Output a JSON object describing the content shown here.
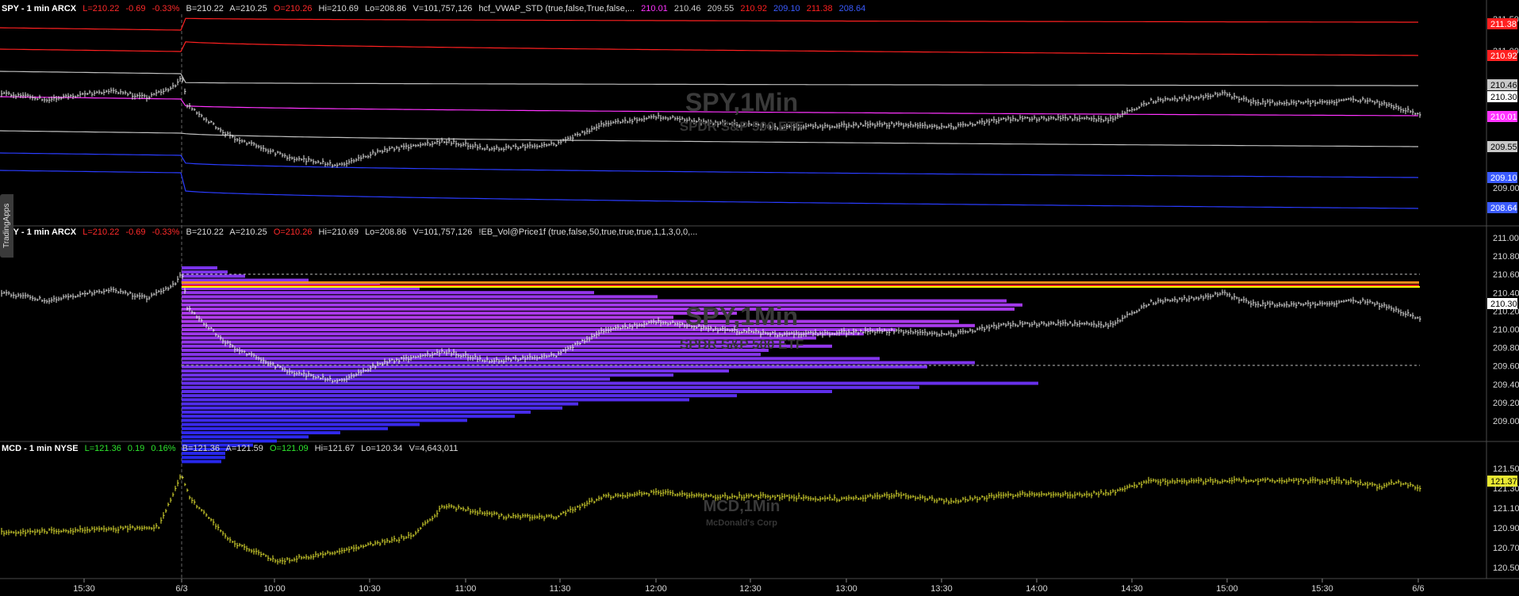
{
  "panels": [
    {
      "id": "spy-vwap",
      "header": {
        "symbol": "SPY - 1 min  ARCX",
        "last": "L=210.22",
        "change": "-0.69",
        "change_pct": "-0.33%",
        "bid": "B=210.22",
        "ask": "A=210.25",
        "open": "O=210.26",
        "high": "Hi=210.69",
        "low": "Lo=208.86",
        "volume": "V=101,757,126",
        "study": "hcf_VWAP_STD (true,false,True,false,...",
        "study_values": [
          "210.01",
          "210.46",
          "209.55",
          "210.92",
          "209.10",
          "211.38",
          "208.64"
        ],
        "study_value_colors": [
          "#ff33ff",
          "#c8c8c8",
          "#c8c8c8",
          "#ff2020",
          "#3a5bff",
          "#ff2020",
          "#3a5bff"
        ]
      },
      "watermark": {
        "title": "SPY,1Min",
        "subtitle": "SPDR S&P 500 ETF"
      },
      "axis_ticks": [
        "211.50",
        "211.00",
        "209.00"
      ],
      "price_labels": [
        {
          "text": "211.38",
          "color": "#ff2020",
          "value": 211.38
        },
        {
          "text": "210.92",
          "color": "#ff2020",
          "value": 210.92
        },
        {
          "text": "210.46",
          "color": "#c8c8c8",
          "value": 210.46
        },
        {
          "text": "210.30",
          "color": "#ffffff",
          "value": 210.3
        },
        {
          "text": "210.01",
          "color": "#ff33ff",
          "value": 210.01
        },
        {
          "text": "209.55",
          "color": "#c8c8c8",
          "value": 209.55
        },
        {
          "text": "209.10",
          "color": "#3a5bff",
          "value": 209.1
        },
        {
          "text": "208.64",
          "color": "#3a5bff",
          "value": 208.64
        }
      ]
    },
    {
      "id": "spy-volprofile",
      "header": {
        "symbol": "SPY - 1 min  ARCX",
        "last": "L=210.22",
        "change": "-0.69",
        "change_pct": "-0.33%",
        "bid": "B=210.22",
        "ask": "A=210.25",
        "open": "O=210.26",
        "high": "Hi=210.69",
        "low": "Lo=208.86",
        "volume": "V=101,757,126",
        "study": "!EB_Vol@Price1f (true,false,50,true,true,true,1,1,3,0,0,..."
      },
      "watermark": {
        "title": "SPY,1Min",
        "subtitle": "SPDR S&P 500 ETF"
      },
      "axis_ticks": [
        "211.00",
        "210.80",
        "210.60",
        "210.40",
        "210.20",
        "210.00",
        "209.80",
        "209.60",
        "209.40",
        "209.20",
        "209.00"
      ],
      "last_label": "210.30"
    },
    {
      "id": "mcd",
      "header": {
        "symbol": "MCD - 1 min  NYSE",
        "last": "L=121.36",
        "change": "0.19",
        "change_pct": "0.16%",
        "bid": "B=121.36",
        "ask": "A=121.59",
        "open": "O=121.09",
        "high": "Hi=121.67",
        "low": "Lo=120.34",
        "volume": "V=4,643,011"
      },
      "watermark": {
        "title": "MCD,1Min",
        "subtitle": "McDonald's Corp"
      },
      "axis_ticks": [
        "121.50",
        "121.30",
        "121.10",
        "120.90",
        "120.70",
        "120.50"
      ],
      "last_label": "121.37"
    }
  ],
  "side_tab": "TradingApps",
  "time_axis": [
    "15:30",
    "6/3",
    "10:00",
    "10:30",
    "11:00",
    "11:30",
    "12:00",
    "12:30",
    "13:00",
    "13:30",
    "14:00",
    "14:30",
    "15:00",
    "15:30",
    "6/6"
  ],
  "colors": {
    "background": "#000000",
    "spy_bars": "#e6e6e6",
    "mcd_bars": "#e8e832",
    "vwap_line": "#c0c0c0",
    "poc_line": "#ffff00",
    "profile_low": "#2a2aff",
    "profile_high": "#c040ff",
    "band_1": "#ff33ff",
    "band_2": "#ff2020",
    "band_3": "#2a3cff"
  }
}
